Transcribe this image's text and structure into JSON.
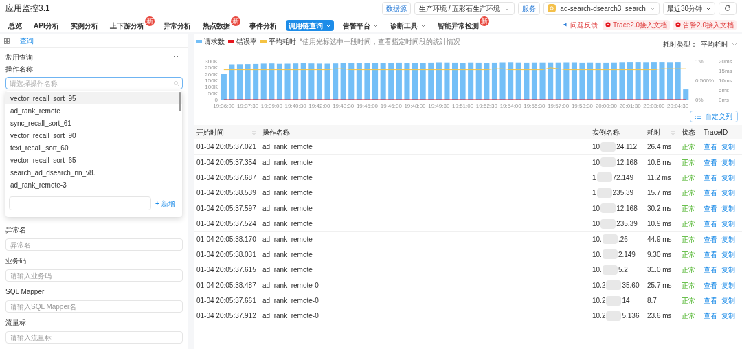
{
  "app_title": "应用监控3.1",
  "header_controls": {
    "datasource_label": "数据源",
    "environment": "生产环境 / 五彩石生产环境",
    "service_label": "服务",
    "service": "ad-search-dsearch3_search",
    "time_range": "最近30分钟"
  },
  "nav_tabs": [
    {
      "label": "总览",
      "selected": false,
      "dropdown": false
    },
    {
      "label": "API分析",
      "selected": false,
      "dropdown": false
    },
    {
      "label": "实例分析",
      "selected": false,
      "dropdown": false
    },
    {
      "label": "上下游分析",
      "selected": false,
      "dropdown": false,
      "badge": "新"
    },
    {
      "label": "异常分析",
      "selected": false,
      "dropdown": false
    },
    {
      "label": "热点数据",
      "selected": false,
      "dropdown": false,
      "badge": "新"
    },
    {
      "label": "事件分析",
      "selected": false,
      "dropdown": false
    },
    {
      "label": "调用链查询",
      "selected": true,
      "dropdown": true
    },
    {
      "label": "告警平台",
      "selected": false,
      "dropdown": true
    },
    {
      "label": "诊断工具",
      "selected": false,
      "dropdown": true
    },
    {
      "label": "智能异常检测",
      "selected": false,
      "dropdown": false,
      "badge": "新"
    }
  ],
  "header_links": [
    {
      "label": "问题反馈",
      "kind": "feedback"
    },
    {
      "label": "Trace2.0接入文档",
      "kind": "doc"
    },
    {
      "label": "告警2.0接入文档",
      "kind": "doc"
    }
  ],
  "sidebar": {
    "tab": "查询",
    "section": "常用查询",
    "operation_field": {
      "label": "操作名称",
      "placeholder": "请选择操作名称"
    },
    "dropdown_options": [
      {
        "label": "vector_recall_sort_95",
        "selected": true
      },
      {
        "label": "ad_rank_remote",
        "selected": false
      },
      {
        "label": "sync_recall_sort_61",
        "selected": false
      },
      {
        "label": "vector_recall_sort_90",
        "selected": false
      },
      {
        "label": "text_recall_sort_60",
        "selected": false
      },
      {
        "label": "vector_recall_sort_65",
        "selected": false
      },
      {
        "label": "search_ad_dsearch_nn_v8.",
        "selected": false
      },
      {
        "label": "ad_rank_remote-3",
        "selected": false
      }
    ],
    "dropdown_add": "+ 新增",
    "fields": [
      {
        "label": "异常名",
        "placeholder": "异常名"
      },
      {
        "label": "业务码",
        "placeholder": "请输入业务码"
      },
      {
        "label": "SQL Mapper",
        "placeholder": "请输入SQL Mapper名"
      },
      {
        "label": "流量标",
        "placeholder": "请输入流量标"
      }
    ]
  },
  "chart_hint": "*使用光标选中一段时间，查看指定时间段的统计情况",
  "latency_type": {
    "label": "耗时类型：",
    "value": "平均耗时"
  },
  "chart_data": {
    "type": "bar",
    "series": [
      {
        "name": "请求数",
        "axis": "y",
        "color": "#74bff7",
        "values": [
          200000,
          276000,
          277000,
          278000,
          279000,
          282000,
          283000,
          280000,
          281000,
          283000,
          284000,
          283000,
          282000,
          281000,
          283000,
          285000,
          285000,
          284000,
          286000,
          286000,
          287000,
          287000,
          290000,
          289000,
          288000,
          288000,
          290000,
          292000,
          291000,
          290000,
          289000,
          291000,
          290000,
          289000,
          290000,
          292000,
          293000,
          291000,
          290000,
          291000,
          291000,
          291000,
          291000,
          292000,
          292000,
          290000,
          291000,
          290000,
          290000,
          291000,
          293000,
          294000,
          294000,
          293000,
          294000,
          294000,
          293000,
          294000,
          80000
        ]
      },
      {
        "name": "错误率",
        "type": "line",
        "axis": "y2",
        "color": "#e5171f",
        "values": [
          0,
          0,
          0,
          0,
          0,
          0,
          0,
          0,
          0,
          0,
          0,
          0,
          0,
          0,
          0,
          0,
          0,
          0,
          0,
          0,
          0,
          0,
          0,
          0,
          0,
          0,
          0,
          0,
          0,
          0,
          0,
          0,
          0,
          0,
          0,
          0,
          0,
          0,
          0,
          0,
          0,
          0,
          0,
          0,
          0,
          0,
          0,
          0,
          0,
          0,
          0,
          0,
          0,
          0,
          0,
          0,
          0,
          0,
          0
        ]
      },
      {
        "name": "平均耗时",
        "type": "line",
        "axis": "y3",
        "color": "#f5c342",
        "values": [
          15.5,
          15.5,
          15.5,
          15.5,
          15.5,
          15.5,
          15.5,
          15.5,
          15.5,
          15.5,
          15.5,
          15.5,
          15.5,
          15.5,
          16,
          16,
          15.5,
          15.5,
          15.5,
          15.5,
          15.5,
          15.5,
          15.5,
          15.5,
          15.5,
          15.5,
          15.5,
          15.5,
          15.5,
          15.5,
          15.5,
          15.5,
          15.5,
          15.5,
          16,
          16,
          15.5,
          15.5,
          15.5,
          15.5,
          15.5,
          16.5,
          16,
          15.5,
          15.5,
          15.5,
          15.5,
          15.5,
          15.5,
          15.5,
          15.5,
          15.5,
          15.5,
          15.5,
          15.5,
          16,
          16,
          16,
          16
        ]
      }
    ],
    "categories": [
      "19:36:00",
      null,
      null,
      "19:37:30",
      null,
      null,
      "19:39:00",
      null,
      null,
      "19:40:30",
      null,
      null,
      "19:42:00",
      null,
      null,
      "19:43:30",
      null,
      null,
      "19:45:00",
      null,
      null,
      "19:46:30",
      null,
      null,
      "19:48:00",
      null,
      null,
      "19:49:30",
      null,
      null,
      "19:51:00",
      null,
      null,
      "19:52:30",
      null,
      null,
      "19:54:00",
      null,
      null,
      "19:55:30",
      null,
      null,
      "19:57:00",
      null,
      null,
      "19:58:30",
      null,
      null,
      "20:00:00",
      null,
      null,
      "20:01:30",
      null,
      null,
      "20:03:00",
      null,
      null,
      "20:04:30",
      null
    ],
    "ylim": [
      0,
      300000
    ],
    "yticks": [
      {
        "value": 0,
        "label": "0"
      },
      {
        "value": 50000,
        "label": "50K"
      },
      {
        "value": 100000,
        "label": "100K"
      },
      {
        "value": 150000,
        "label": "150K"
      },
      {
        "value": 200000,
        "label": "200K"
      },
      {
        "value": 250000,
        "label": "250K"
      },
      {
        "value": 300000,
        "label": "300K"
      }
    ],
    "y2lim": [
      0,
      0.01
    ],
    "y2ticks": [
      {
        "value": 0,
        "label": "0%"
      },
      {
        "value": 0.005,
        "label": "0.500%"
      },
      {
        "value": 0.01,
        "label": "1%"
      }
    ],
    "y3lim": [
      0,
      20
    ],
    "y3ticks": [
      {
        "value": 0,
        "label": "0ms"
      },
      {
        "value": 5,
        "label": "5ms"
      },
      {
        "value": 10,
        "label": "10ms"
      },
      {
        "value": 15,
        "label": "15ms"
      },
      {
        "value": 20,
        "label": "20ms"
      }
    ]
  },
  "custom_columns_button": "自定义列",
  "table": {
    "columns": [
      {
        "label": "开始时间",
        "sortable": true
      },
      {
        "label": "操作名称",
        "sortable": false
      },
      {
        "label": "实例名称",
        "sortable": false
      },
      {
        "label": "耗时",
        "sortable": true
      },
      {
        "label": "状态",
        "sortable": false
      },
      {
        "label": "TraceID",
        "sortable": false
      }
    ],
    "rows": [
      {
        "start": "01-04 20:05:37.021",
        "operation": "ad_rank_remote",
        "instance_start": "10",
        "instance_end": "24.112",
        "duration": "26.4 ms",
        "status": "正常",
        "actions": [
          "查看",
          "复制"
        ]
      },
      {
        "start": "01-04 20:05:37.354",
        "operation": "ad_rank_remote",
        "instance_start": "10",
        "instance_end": "12.168",
        "duration": "10.8 ms",
        "status": "正常",
        "actions": [
          "查看",
          "复制"
        ]
      },
      {
        "start": "01-04 20:05:37.687",
        "operation": "ad_rank_remote",
        "instance_start": "1",
        "instance_end": "72.149",
        "duration": "11.2 ms",
        "status": "正常",
        "actions": [
          "查看",
          "复制"
        ]
      },
      {
        "start": "01-04 20:05:38.539",
        "operation": "ad_rank_remote",
        "instance_start": "1",
        "instance_end": "235.39",
        "duration": "15.7 ms",
        "status": "正常",
        "actions": [
          "查看",
          "复制"
        ]
      },
      {
        "start": "01-04 20:05:37.597",
        "operation": "ad_rank_remote",
        "instance_start": "10",
        "instance_end": "12.168",
        "duration": "30.2 ms",
        "status": "正常",
        "actions": [
          "查看",
          "复制"
        ]
      },
      {
        "start": "01-04 20:05:37.524",
        "operation": "ad_rank_remote",
        "instance_start": "10",
        "instance_end": "235.39",
        "duration": "10.9 ms",
        "status": "正常",
        "actions": [
          "查看",
          "复制"
        ]
      },
      {
        "start": "01-04 20:05:38.170",
        "operation": "ad_rank_remote",
        "instance_start": "10.",
        "instance_end": ".26",
        "duration": "44.9 ms",
        "status": "正常",
        "actions": [
          "查看",
          "复制"
        ]
      },
      {
        "start": "01-04 20:05:38.031",
        "operation": "ad_rank_remote",
        "instance_start": "10.",
        "instance_end": "2.149",
        "duration": "9.30 ms",
        "status": "正常",
        "actions": [
          "查看",
          "复制"
        ]
      },
      {
        "start": "01-04 20:05:37.615",
        "operation": "ad_rank_remote",
        "instance_start": "10.",
        "instance_end": "5.2",
        "duration": "31.0 ms",
        "status": "正常",
        "actions": [
          "查看",
          "复制"
        ]
      },
      {
        "start": "01-04 20:05:38.487",
        "operation": "ad_rank_remote-0",
        "instance_start": "10.2",
        "instance_end": "35.60",
        "duration": "25.7 ms",
        "status": "正常",
        "actions": [
          "查看",
          "复制"
        ]
      },
      {
        "start": "01-04 20:05:37.661",
        "operation": "ad_rank_remote-0",
        "instance_start": "10.2",
        "instance_end": "14",
        "duration": "8.7",
        "status": "正常",
        "actions": [
          "查看",
          "复制"
        ]
      },
      {
        "start": "01-04 20:05:37.912",
        "operation": "ad_rank_remote-0",
        "instance_start": "10.2",
        "instance_end": "5.136",
        "duration": "23.6 ms",
        "status": "正常",
        "actions": [
          "查看",
          "复制"
        ]
      }
    ]
  }
}
